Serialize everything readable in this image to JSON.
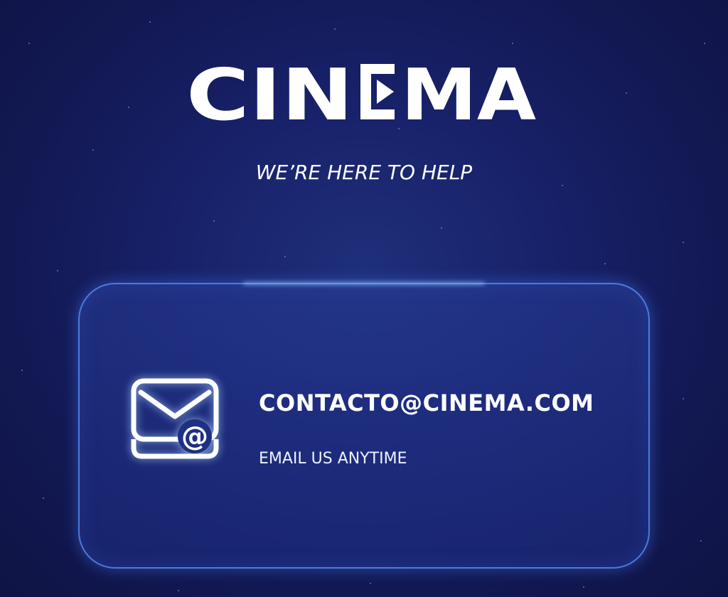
{
  "brand": {
    "logo_text": "CINEMA",
    "logo_left": "CIN",
    "logo_right": "MA"
  },
  "tagline": "WE’RE HERE TO HELP",
  "contact": {
    "email": "CONTACTO@CINEMA.COM",
    "caption": "EMAIL US ANYTIME",
    "icon": "envelope-at-icon"
  },
  "colors": {
    "background": "#141b5a",
    "card_border": "#5f96ff",
    "text": "#ffffff"
  }
}
